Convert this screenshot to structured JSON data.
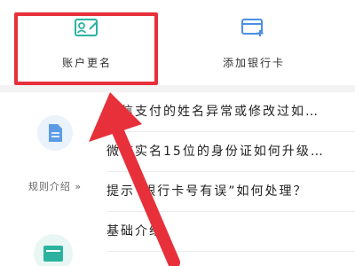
{
  "actions": {
    "rename_label": "账户更名",
    "add_card_label": "添加银行卡"
  },
  "category": {
    "label": "规则介绍 »"
  },
  "questions": [
    "微信支付的姓名异常或修改过如…",
    "微信实名15位的身份证如何升级…",
    "提示“银行卡号有误”如何处理？",
    "基础介绍"
  ],
  "colors": {
    "accent_teal": "#2bb3a0",
    "accent_blue": "#4a90e2",
    "annotation_red": "#e7303a"
  },
  "icons": [
    "id-card-edit-icon",
    "bank-card-add-icon",
    "document-icon",
    "card-icon"
  ]
}
